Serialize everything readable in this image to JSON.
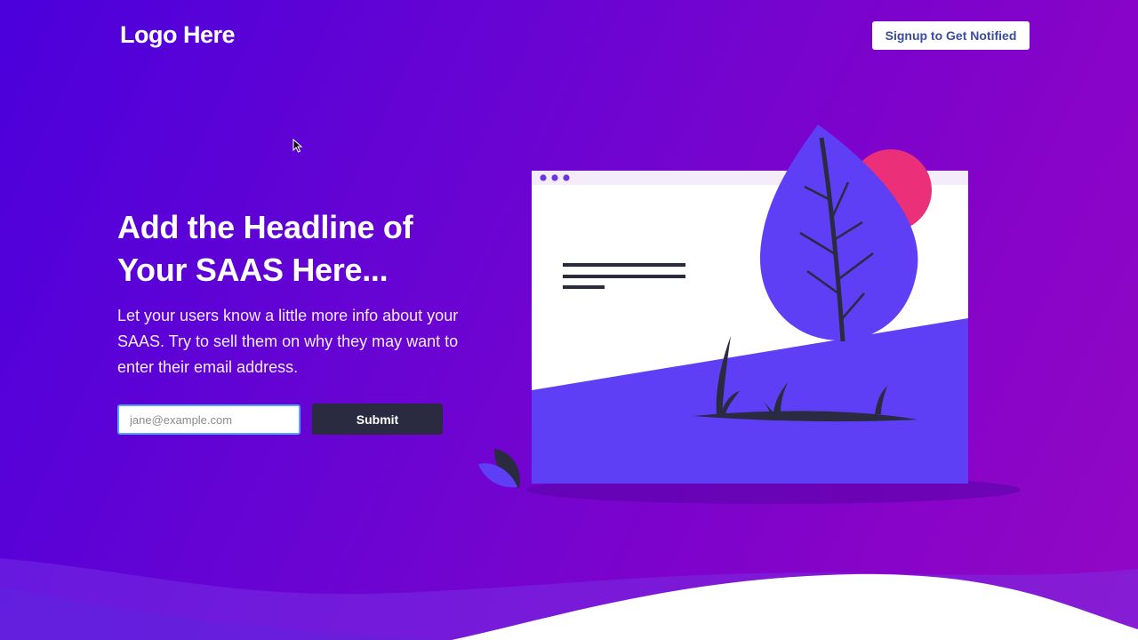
{
  "header": {
    "logo": "Logo Here",
    "signup_button": "Signup to Get Notified"
  },
  "hero": {
    "headline_line1": "Add the Headline of",
    "headline_line2": "Your SAAS Here...",
    "description": "Let your users know a little more info about your SAAS. Try to sell them on why they may want to enter their email address."
  },
  "form": {
    "email_placeholder": "jane@example.com",
    "email_value": "",
    "submit_label": "Submit"
  },
  "icons": [
    "mouse-cursor-icon"
  ],
  "colors": {
    "background_start": "#4b00dc",
    "background_end": "#9208c4",
    "accent_purple": "#5e3ff5",
    "accent_pink": "#ec2f79",
    "dark": "#2a2a40",
    "white": "#ffffff",
    "input_border": "#57a5ff"
  }
}
